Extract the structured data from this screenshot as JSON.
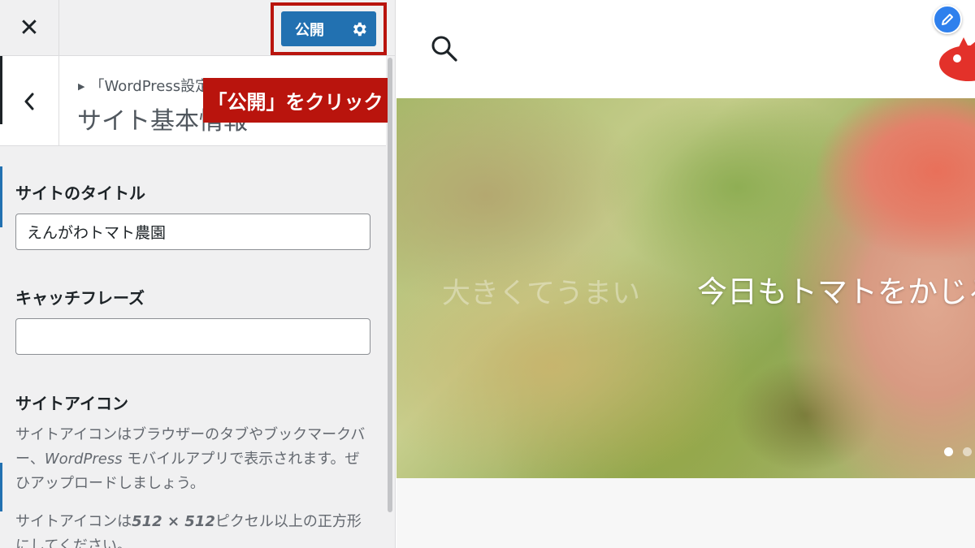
{
  "topbar": {
    "close_icon": "close-icon",
    "publish_label": "公開",
    "settings_icon": "gear-icon"
  },
  "section": {
    "back_icon": "chevron-left-icon",
    "breadcrumb": "「WordPress設定",
    "title": "サイト基本情報"
  },
  "annotation": {
    "callout": "「公開」をクリック",
    "highlight_color": "#b9140d"
  },
  "fields": {
    "site_title": {
      "label": "サイトのタイトル",
      "value": "えんがわトマト農園"
    },
    "tagline": {
      "label": "キャッチフレーズ",
      "value": ""
    },
    "site_icon": {
      "label": "サイトアイコン",
      "desc1_a": "サイトアイコンはブラウザーのタブやブックマークバー、",
      "desc1_b": "WordPress",
      "desc1_c": " モバイルアプリで表示されます。ぜひアップロードしましょう。",
      "desc2_a": "サイトアイコンは",
      "desc2_b": "512 × 512",
      "desc2_c": "ピクセル以上の正方形にしてください。"
    }
  },
  "preview": {
    "search_icon": "search-icon",
    "edit_icon": "pencil-icon",
    "logo_icon": "tomato-logo",
    "hero_text": "今日もトマトをかじる",
    "hero_text_faded": "大きくてうまい"
  },
  "colors": {
    "accent": "#2271b1",
    "sidebar_bg": "#f0f0f1",
    "callout_bg": "#b9140d"
  }
}
